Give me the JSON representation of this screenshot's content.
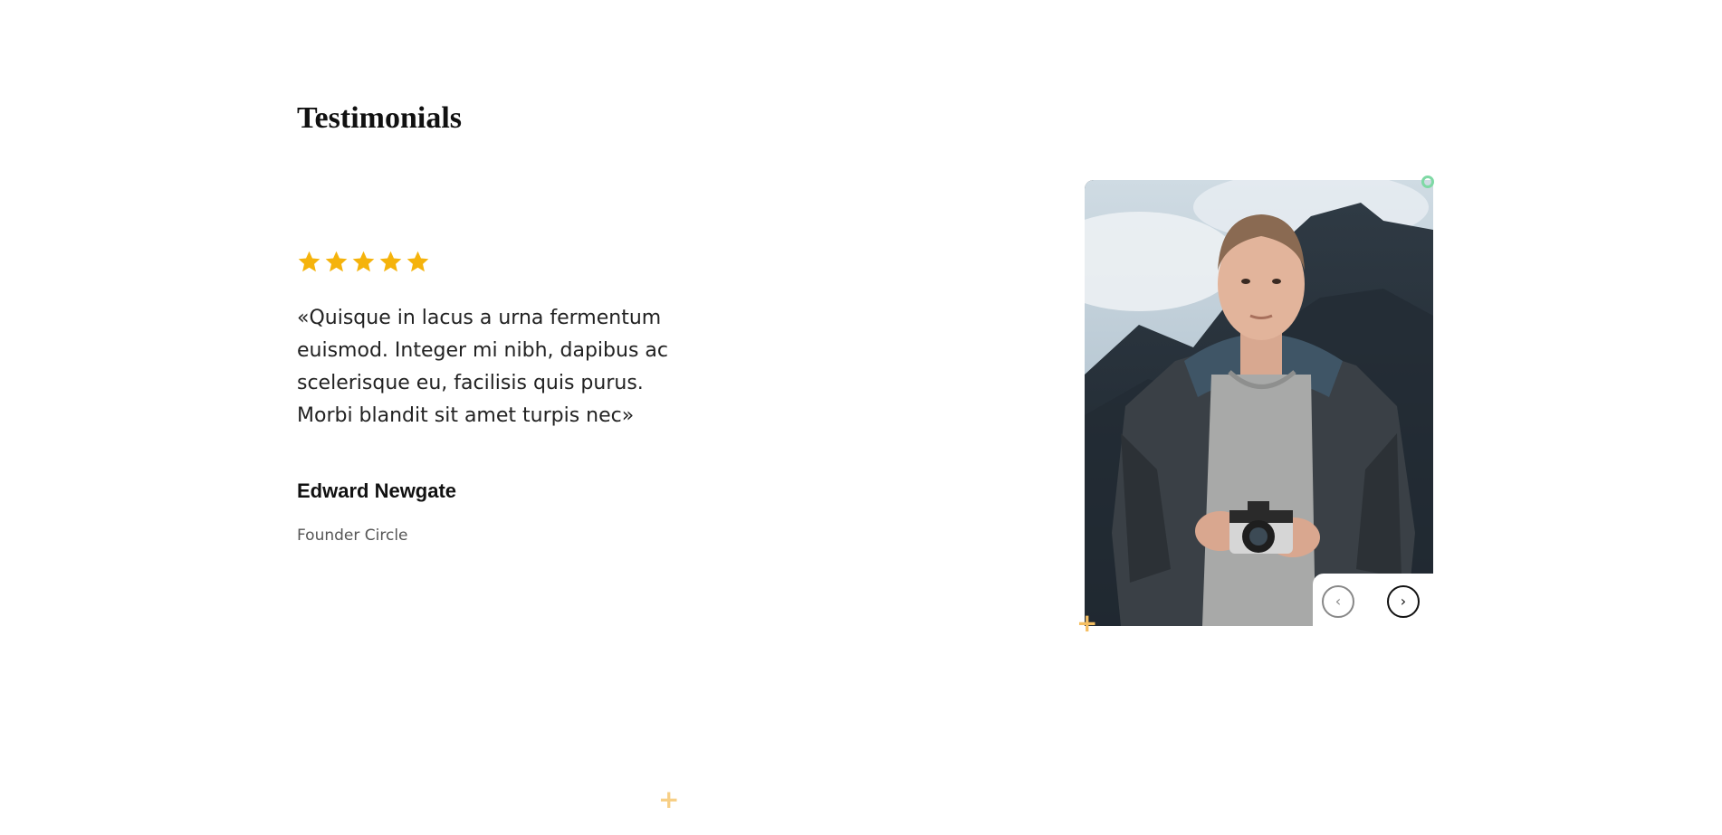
{
  "section": {
    "title": "Testimonials"
  },
  "testimonial": {
    "rating": 5,
    "rating_max": 5,
    "quote": "«Quisque in lacus a urna fermentum euismod. Integer mi nibh, dapibus ac scelerisque eu, facilisis quis purus. Morbi blandit sit amet turpis nec»",
    "author_name": "Edward Newgate",
    "author_role": "Founder Circle",
    "photo_icon": "portrait-photo"
  },
  "navigation": {
    "prev_symbol": "‹",
    "next_symbol": "›",
    "prev_icon": "chevron-left-icon",
    "next_icon": "chevron-right-icon"
  },
  "colors": {
    "star": "#f5b30c",
    "accent_plus": "#f5bf62",
    "accent_circle": "#7fd9a5",
    "text_dark": "#111111",
    "text_muted": "#555555"
  }
}
